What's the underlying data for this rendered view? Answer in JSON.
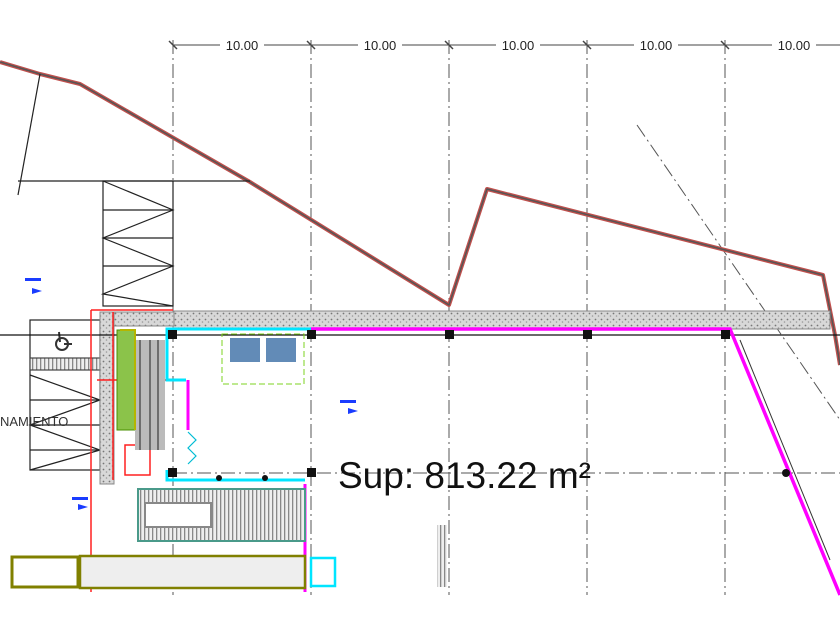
{
  "drawing": {
    "dimensions": [
      "10.00",
      "10.00",
      "10.00",
      "10.00",
      "10.00"
    ],
    "area_label": "Sup: 813.22 m²",
    "room_label": "NAMIENTO"
  },
  "colors": {
    "lot_line": "#c0504d",
    "boundary": "#ff00ff",
    "wall": "#00e5ff",
    "accent_red": "#ff2020",
    "vehicle": "#808000"
  }
}
